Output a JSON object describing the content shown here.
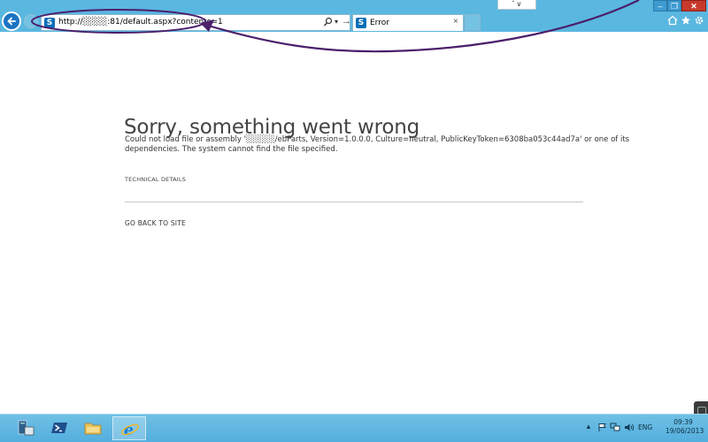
{
  "browser": {
    "address_url": "http://░░░░:81/default.aspx?contents=1",
    "tab_title": "Error",
    "tab_close": "×",
    "site_icon_letter": "S",
    "address_dropdown": "▾",
    "go_arrow": "→",
    "top_dropdown": "ˇ ∨",
    "minimize": "–",
    "maximize": "❐",
    "close": "✕"
  },
  "page": {
    "title": "Sorry, something went wrong",
    "error_line1": "Could not load file or assembly '░░░░░/ebParts, Version=1.0.0.0, Culture=neutral, PublicKeyToken=6308ba053c44ad7a' or one of its",
    "error_line2": "dependencies. The system cannot find the file specified.",
    "technical_details": "TECHNICAL DETAILS",
    "go_back": "GO BACK TO SITE"
  },
  "taskbar": {
    "items": [
      "server-manager-icon",
      "powershell-icon",
      "file-explorer-icon",
      "internet-explorer-icon"
    ],
    "tray_chevron": "▲",
    "language": "ENG",
    "time": "09:39",
    "date": "19/06/2013"
  },
  "colors": {
    "chrome": "#5ab7e0",
    "annotation": "#4b1f6b",
    "close_button": "#c7392b"
  }
}
